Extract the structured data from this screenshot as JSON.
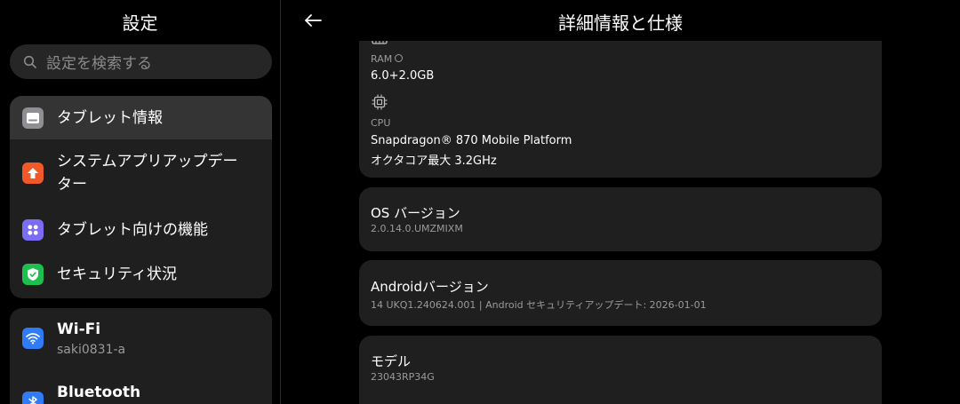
{
  "left": {
    "title": "設定",
    "search_placeholder": "設定を検索する",
    "group1": [
      {
        "label": "タブレット情報",
        "icon": "tablet-icon",
        "color": "#8e8e93",
        "selected": true
      },
      {
        "label": "システムアプリアップデー",
        "label2": "ター",
        "icon": "arrow-up-icon",
        "color": "#f2592a"
      },
      {
        "label": "タブレット向けの機能",
        "icon": "apps-grid-icon",
        "color": "#7b6cf6"
      },
      {
        "label": "セキュリティ状況",
        "icon": "shield-check-icon",
        "color": "#1fbf4f"
      }
    ],
    "group2": [
      {
        "label": "Wi-Fi",
        "sub": "saki0831-a",
        "icon": "wifi-icon",
        "color": "#2f7cf6"
      },
      {
        "label": "Bluetooth",
        "icon": "bluetooth-icon",
        "color": "#2f7cf6"
      }
    ]
  },
  "right": {
    "title": "詳細情報と仕様",
    "ram": {
      "label": "RAM",
      "value": "6.0+2.0GB"
    },
    "cpu": {
      "label": "CPU",
      "value1": "Snapdragon® 870 Mobile Platform",
      "value2": "オクタコア最大 3.2GHz"
    },
    "os": {
      "title": "OS バージョン",
      "value": "2.0.14.0.UMZMIXM"
    },
    "android": {
      "title": "Androidバージョン",
      "value": "14 UKQ1.240624.001 | Android セキュリティアップデート: 2026-01-01"
    },
    "model": {
      "title": "モデル",
      "value": "23043RP34G"
    }
  }
}
